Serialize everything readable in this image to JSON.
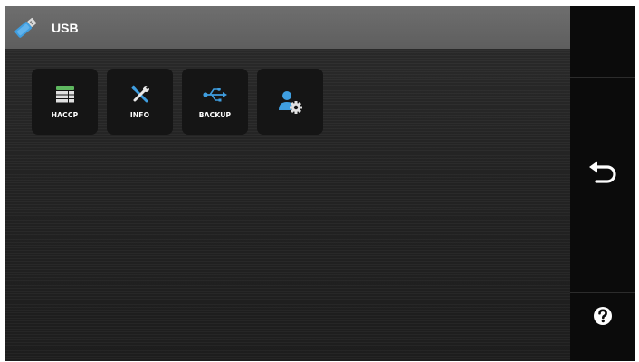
{
  "header": {
    "title": "USB",
    "icon": "usb-stick-icon"
  },
  "tiles": [
    {
      "label": "HACCP",
      "icon": "haccp-table-icon"
    },
    {
      "label": "INFO",
      "icon": "tools-icon"
    },
    {
      "label": "BACKUP",
      "icon": "usb-symbol-icon"
    },
    {
      "label": "",
      "icon": "user-settings-icon"
    }
  ],
  "sidebar": {
    "back_icon": "back-arrow-icon",
    "help_icon": "help-icon"
  },
  "colors": {
    "accent_blue": "#3f9ee0",
    "header_gray": "#666666",
    "haccp_green": "#5fb860"
  }
}
